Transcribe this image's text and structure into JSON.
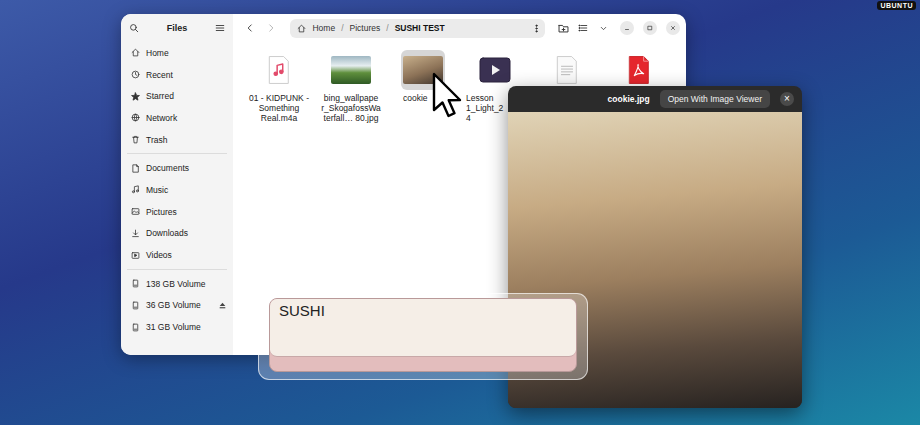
{
  "desktop": {
    "badge": "UBUNTU"
  },
  "files_window": {
    "title": "Files",
    "path": [
      {
        "label": "Home",
        "current": false
      },
      {
        "label": "Pictures",
        "current": false
      },
      {
        "label": "SUSHI TEST",
        "current": true
      }
    ],
    "path_separator": "/",
    "sidebar": {
      "groups": [
        [
          {
            "label": "Home",
            "ejectable": false
          },
          {
            "label": "Recent",
            "ejectable": false
          },
          {
            "label": "Starred",
            "ejectable": false
          },
          {
            "label": "Network",
            "ejectable": false
          },
          {
            "label": "Trash",
            "ejectable": false
          }
        ],
        [
          {
            "label": "Documents",
            "ejectable": false
          },
          {
            "label": "Music",
            "ejectable": false
          },
          {
            "label": "Pictures",
            "ejectable": false
          },
          {
            "label": "Downloads",
            "ejectable": false
          },
          {
            "label": "Videos",
            "ejectable": false
          }
        ],
        [
          {
            "label": "138 GB Volume",
            "ejectable": false
          },
          {
            "label": "36 GB Volume",
            "ejectable": true
          },
          {
            "label": "31 GB Volume",
            "ejectable": false
          }
        ]
      ]
    },
    "files": [
      {
        "kind": "audio",
        "selected": false,
        "name_lines": [
          "01 - KIDPUNK -",
          "Something",
          "Real.m4a"
        ]
      },
      {
        "kind": "image",
        "selected": false,
        "name_lines": [
          "bing_wallpape",
          "r_SkogafossWa",
          "terfall… 80.jpg"
        ]
      },
      {
        "kind": "image",
        "selected": true,
        "name_lines": [
          "cookie"
        ]
      },
      {
        "kind": "video",
        "selected": false,
        "name_lines": [
          "Lesson",
          "1_Light_2",
          "4"
        ]
      },
      {
        "kind": "text",
        "selected": false,
        "name_lines": []
      },
      {
        "kind": "pdf",
        "selected": false,
        "name_lines": []
      }
    ]
  },
  "preview": {
    "title": "cookie.jpg",
    "button": "Open With Image Viewer",
    "close": "×"
  },
  "key": {
    "label": "SUSHI"
  }
}
